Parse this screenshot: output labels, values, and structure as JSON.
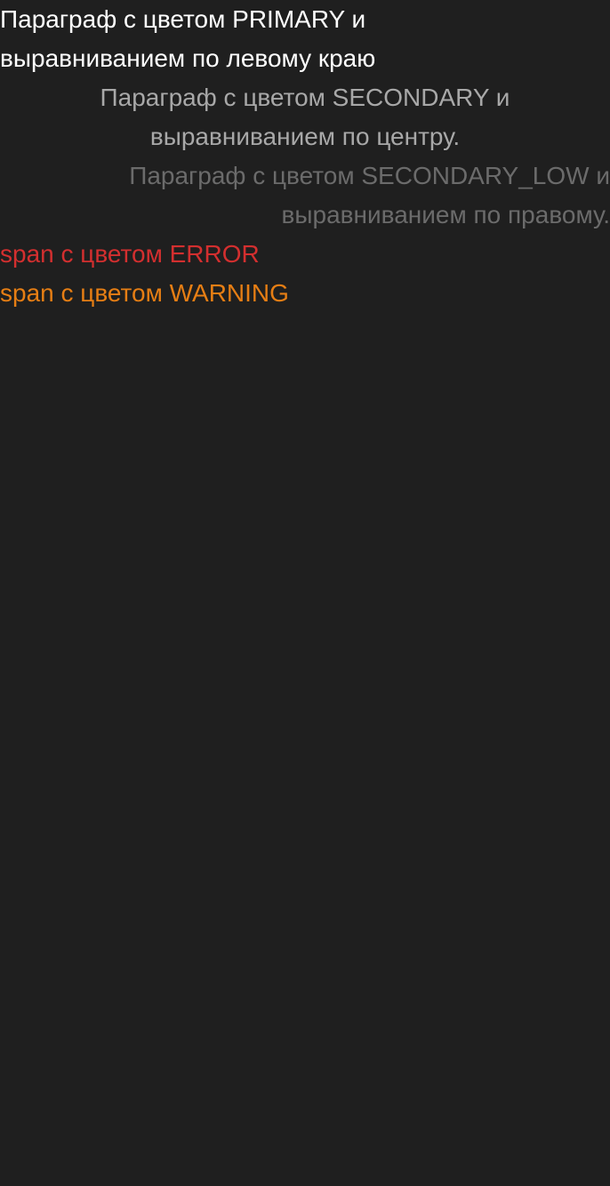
{
  "paragraphs": {
    "primary": "Параграф с цветом PRIMARY и выравниванием по левому краю",
    "secondary": "Параграф с цветом SECONDARY и выравниванием по центру.",
    "secondary_low": "Параграф с цветом SECONDARY_LOW и выравниванием по правому."
  },
  "spans": {
    "error": "span с цветом ERROR",
    "warning": "span с цветом WARNING"
  },
  "colors": {
    "background": "#1f1f1f",
    "primary": "#ffffff",
    "secondary": "#a8a8a8",
    "secondary_low": "#6b6b6b",
    "error": "#d32f2f",
    "warning": "#e67e14"
  }
}
